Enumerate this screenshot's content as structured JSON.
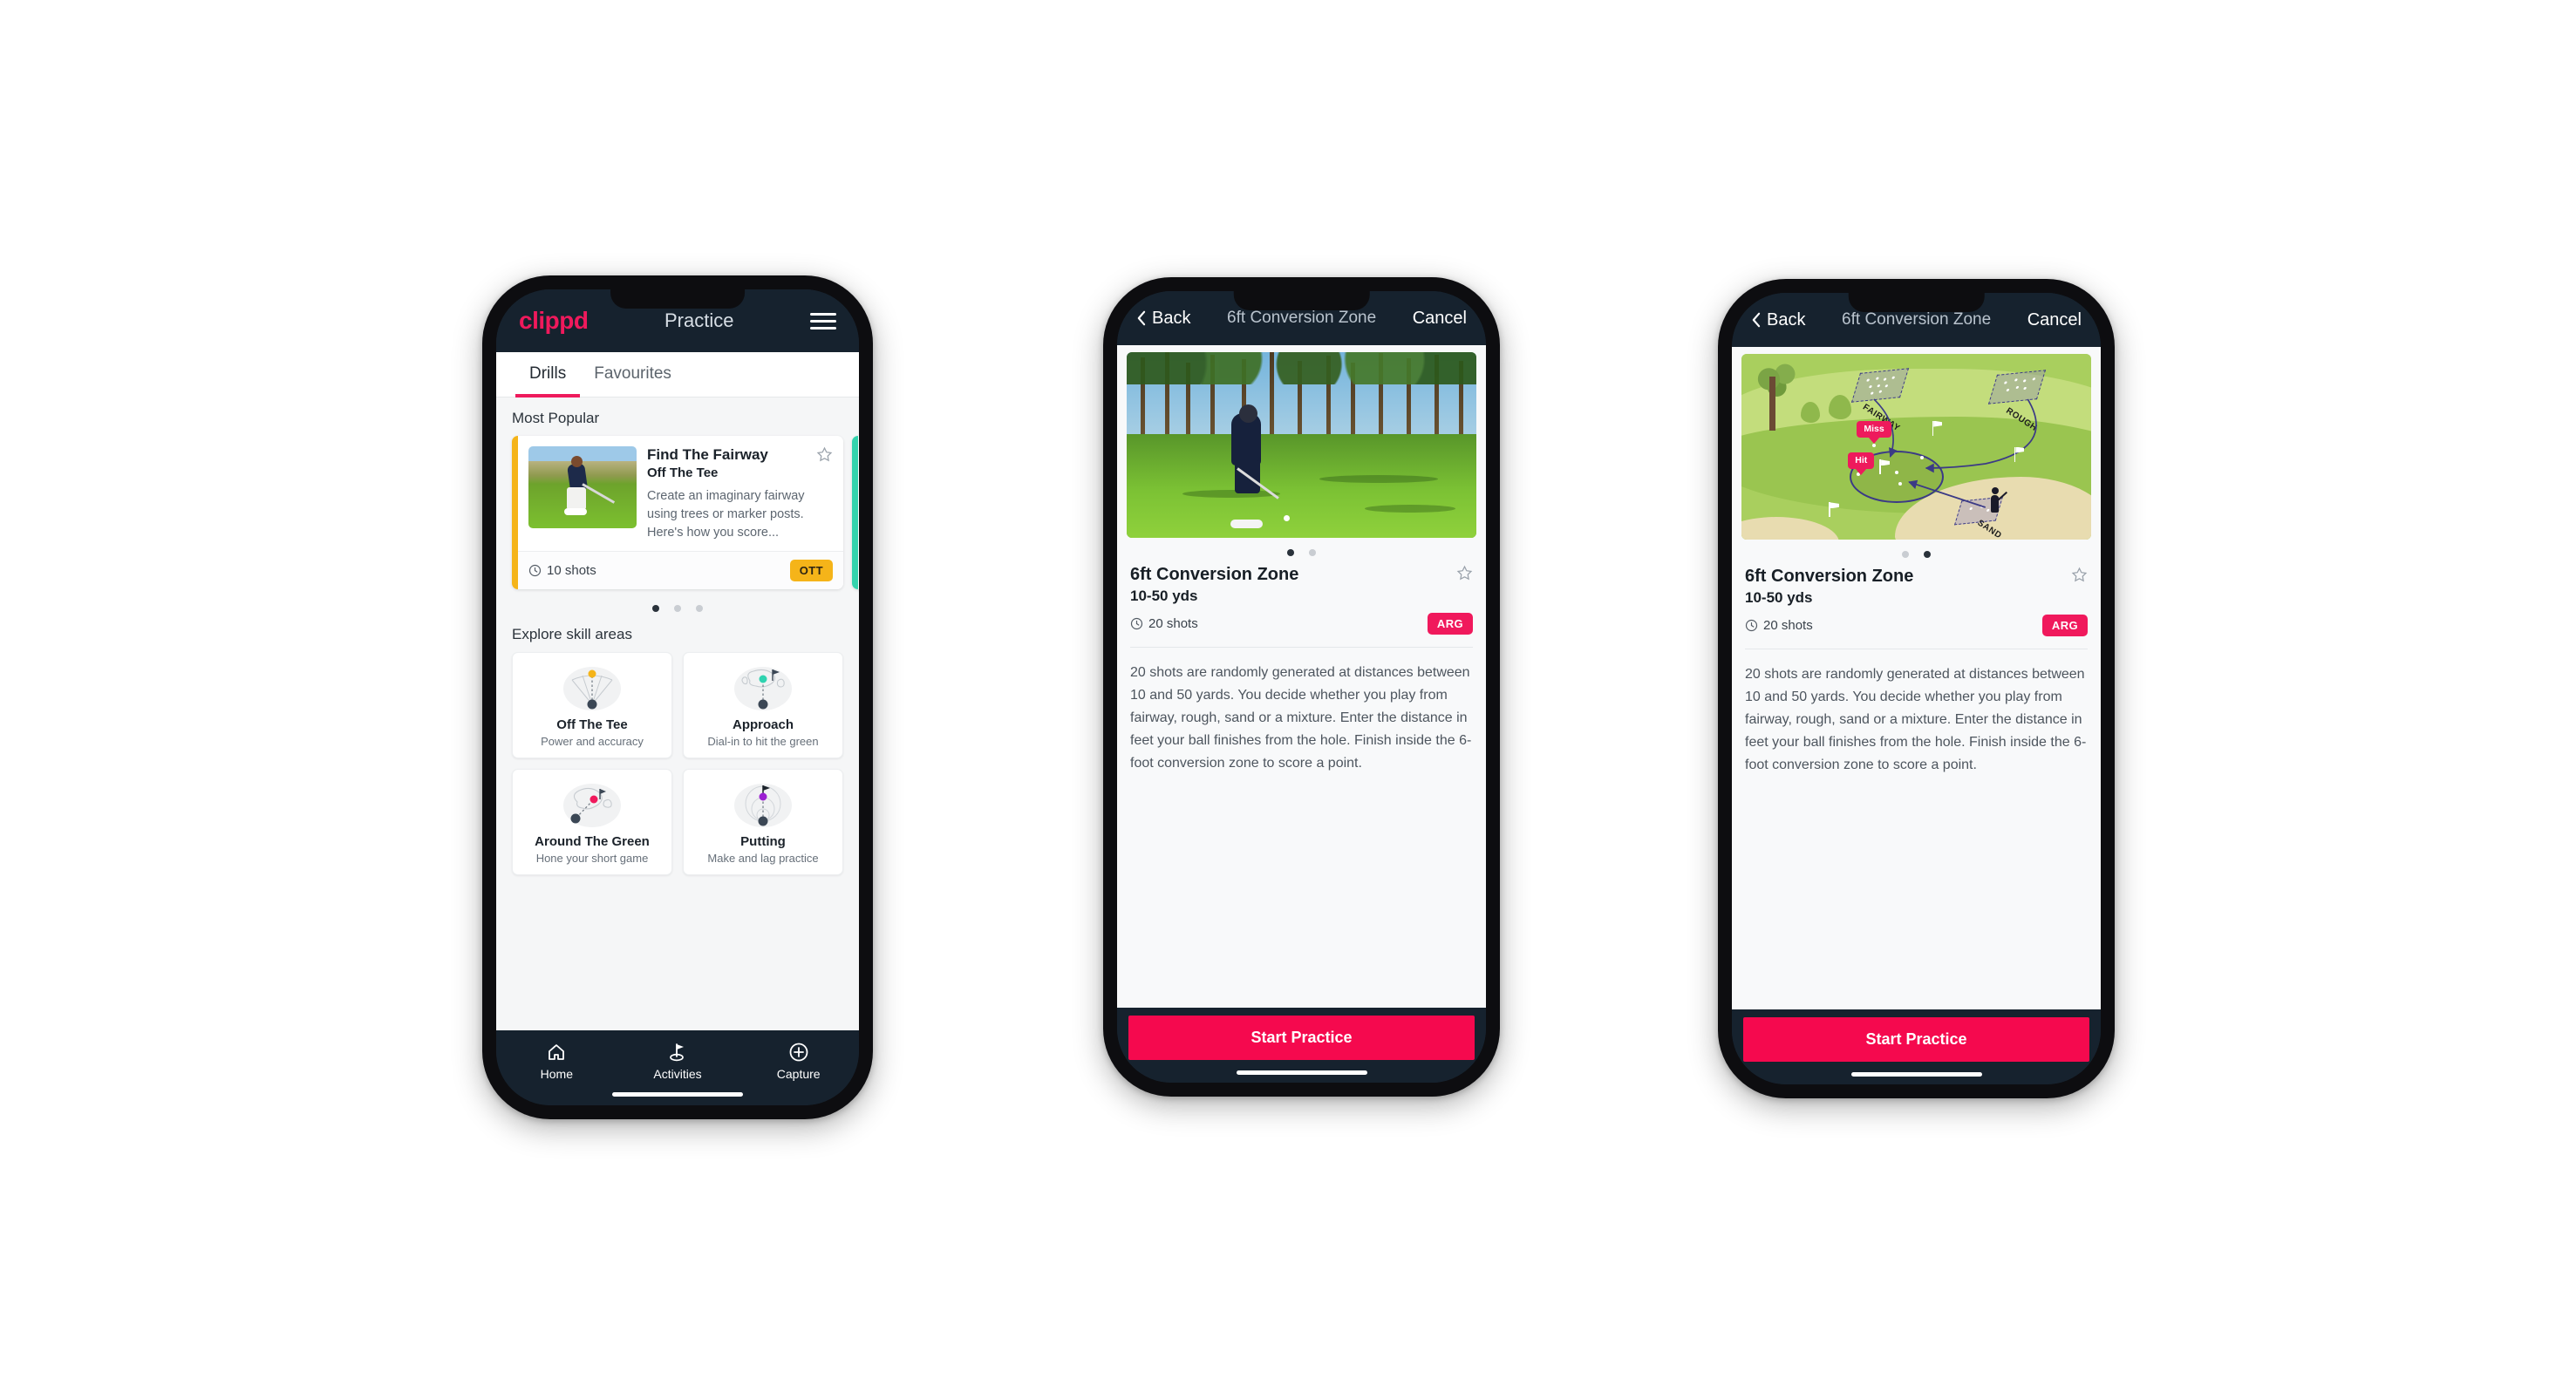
{
  "phone1": {
    "appbar": {
      "logo": "clippd",
      "title": "Practice",
      "menu_icon": "hamburger-icon"
    },
    "tabs": [
      {
        "label": "Drills",
        "active": true
      },
      {
        "label": "Favourites",
        "active": false
      }
    ],
    "most_popular": {
      "section_label": "Most Popular",
      "card": {
        "title": "Find The Fairway",
        "subtitle": "Off The Tee",
        "description": "Create an imaginary fairway using trees or marker posts. Here's how you score...",
        "shots": "10 shots",
        "badge": "OTT",
        "badge_color": "#f5b419",
        "accent_color": "#f5b419",
        "favourite_icon": "star-outline-icon",
        "shots_icon": "clock-icon",
        "thumbnail": "golfer-teeing-off-photo"
      },
      "next_card_accent": "#34d3ad",
      "dots": {
        "count": 3,
        "active_index": 0
      }
    },
    "skill_areas": {
      "section_label": "Explore skill areas",
      "cards": [
        {
          "name": "Off The Tee",
          "tagline": "Power and accuracy",
          "icon": "tee-shot-fan-icon",
          "accent": "#f5b419"
        },
        {
          "name": "Approach",
          "tagline": "Dial-in to hit the green",
          "icon": "approach-green-icon",
          "accent": "#2fd3b0"
        },
        {
          "name": "Around The Green",
          "tagline": "Hone your short game",
          "icon": "chip-green-icon",
          "accent": "#f0195c"
        },
        {
          "name": "Putting",
          "tagline": "Make and lag practice",
          "icon": "putting-rings-icon",
          "accent": "#9b1fd1"
        }
      ]
    },
    "bottom_nav": [
      {
        "label": "Home",
        "icon": "home-icon",
        "active": false
      },
      {
        "label": "Activities",
        "icon": "golf-flag-icon",
        "active": true
      },
      {
        "label": "Capture",
        "icon": "plus-circle-icon",
        "active": false
      }
    ]
  },
  "phone2": {
    "appbar": {
      "back_label": "Back",
      "back_icon": "chevron-left-icon",
      "title": "6ft Conversion Zone",
      "cancel_label": "Cancel"
    },
    "media": "golfer-chipping-photo",
    "dots": {
      "count": 2,
      "active_index": 0
    },
    "detail": {
      "name": "6ft Conversion Zone",
      "range": "10-50 yds",
      "shots": "20 shots",
      "shots_icon": "clock-icon",
      "badge": "ARG",
      "badge_color": "#f0195c",
      "favourite_icon": "star-outline-icon",
      "description": "20 shots are randomly generated at distances between 10 and 50 yards. You decide whether you play from fairway, rough, sand or a mixture. Enter the distance in feet your ball finishes from the hole. Finish inside the 6-foot conversion zone to score a point."
    },
    "cta": {
      "label": "Start Practice",
      "color": "#f5094e"
    }
  },
  "phone3": {
    "appbar": {
      "back_label": "Back",
      "back_icon": "chevron-left-icon",
      "title": "6ft Conversion Zone",
      "cancel_label": "Cancel"
    },
    "media": "course-diagram-illustration",
    "course_labels": {
      "fairway": "FAIRWAY",
      "rough": "ROUGH",
      "sand": "SAND",
      "miss_pin": "Miss",
      "hit_pin": "Hit"
    },
    "dots": {
      "count": 2,
      "active_index": 1
    },
    "detail": {
      "name": "6ft Conversion Zone",
      "range": "10-50 yds",
      "shots": "20 shots",
      "shots_icon": "clock-icon",
      "badge": "ARG",
      "badge_color": "#f0195c",
      "favourite_icon": "star-outline-icon",
      "description": "20 shots are randomly generated at distances between 10 and 50 yards. You decide whether you play from fairway, rough, sand or a mixture. Enter the distance in feet your ball finishes from the hole. Finish inside the 6-foot conversion zone to score a point."
    },
    "cta": {
      "label": "Start Practice",
      "color": "#f5094e"
    }
  }
}
